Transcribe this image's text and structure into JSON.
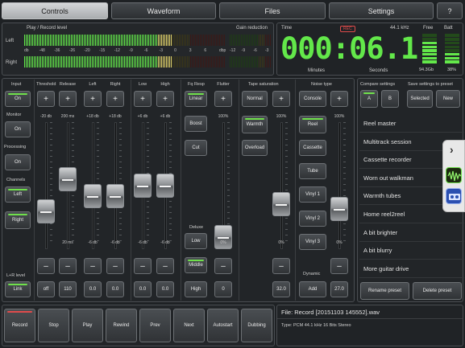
{
  "tabs": [
    {
      "label": "Controls",
      "active": true
    },
    {
      "label": "Waveform",
      "active": false
    },
    {
      "label": "Files",
      "active": false
    },
    {
      "label": "Settings",
      "active": false
    },
    {
      "label": "?",
      "active": false
    }
  ],
  "meter": {
    "title": "Play / Record level",
    "gain_title": "Gain reduction",
    "left": "Left",
    "right": "Right",
    "scale": [
      "db",
      "-48",
      "-36",
      "-26",
      "-20",
      "-15",
      "-12",
      "-9",
      "-6",
      "-3",
      "0",
      "3",
      "6",
      "dbp"
    ],
    "gain_scale": [
      "-12",
      "-9",
      "-6",
      "-3"
    ]
  },
  "clock": {
    "time_label": "Time",
    "rec_badge": "REC",
    "rate": "44.1 kHz",
    "free_label": "Free",
    "batt_label": "Batt",
    "digits": "000:06.1",
    "minutes_label": "Minutes",
    "seconds_label": "Seconds",
    "free_value": "94.3Gb",
    "batt_value": "38%",
    "free_level": 0.7,
    "batt_level": 0.38
  },
  "channels": [
    {
      "key": "threshold",
      "header": "Threshold",
      "top": "-20 db",
      "bottom": "",
      "value": "off",
      "level": 0.25
    },
    {
      "key": "release",
      "header": "Release",
      "top": "200 ms",
      "bottom": "20 ms",
      "value": "110",
      "level": 0.56
    },
    {
      "key": "left",
      "header": "Left",
      "top": "+18 db",
      "bottom": "-6 db",
      "value": "0.0",
      "level": 0.4
    },
    {
      "key": "right",
      "header": "Right",
      "top": "+18 db",
      "bottom": "-6 db",
      "value": "0.0",
      "level": 0.4
    },
    {
      "key": "low",
      "header": "Low",
      "top": "+6 db",
      "bottom": "-6 db",
      "value": "0.0",
      "level": 0.5
    },
    {
      "key": "high",
      "header": "High",
      "top": "+6 db",
      "bottom": "-6 db",
      "value": "0.0",
      "level": 0.5
    },
    {
      "key": "flutter",
      "header": "Flutter",
      "top": "100%",
      "bottom": "0%",
      "value": "0",
      "level": 0.0
    },
    {
      "key": "saturation",
      "header": "",
      "top": "100%",
      "bottom": "0%",
      "value": "32.0",
      "level": 0.32
    },
    {
      "key": "noise",
      "header": "",
      "top": "100%",
      "bottom": "0%",
      "value": "27.0",
      "level": 0.27
    }
  ],
  "input_col": {
    "header": "Input",
    "on_label": "On",
    "monitor": "Monitor",
    "monitor_on": "On",
    "processing": "Processing",
    "processing_on": "On",
    "channels": "Channels",
    "left_btn": "Left",
    "right_btn": "Right",
    "lr_level": "L+R level",
    "link": "Link"
  },
  "freq": {
    "header": "Fq Resp",
    "linear": "Linear",
    "boost": "Boost",
    "cut": "Cut",
    "deluxe": "Deluxe",
    "low": "Low",
    "middle": "Middle",
    "high": "High"
  },
  "saturation": {
    "header": "Tape saturation",
    "normal": "Normal",
    "warmth": "Warmth",
    "overload": "Overload"
  },
  "noise": {
    "header": "Noise type",
    "console": "Console",
    "reel": "Reel",
    "cassette": "Cassette",
    "tube": "Tube",
    "vinyl1": "Vinyl 1",
    "vinyl2": "Vinyl 2",
    "vinyl3": "Vinyl 3",
    "dynamic": "Dynamic",
    "add": "Add"
  },
  "presets": {
    "compare_label": "Compare settings",
    "save_label": "Save settings to preset",
    "a": "A",
    "b": "B",
    "selected": "Selected",
    "new": "New",
    "items": [
      "Reel master",
      "Multitrack session",
      "Cassette recorder",
      "Worn out walkman",
      "Warmth tubes",
      "Home reel2reel",
      "A bit brighter",
      "A bit blurry",
      "More guitar drive"
    ],
    "rename": "Rename preset",
    "delete": "Delete preset"
  },
  "transport": [
    "Record",
    "Stop",
    "Play",
    "Rewind",
    "Prev",
    "Next",
    "Autostart",
    "Dubbing"
  ],
  "file": {
    "name": "File: Record [20151103 145552].wav",
    "type": "Type: PCM 44.1 kHz 16 Bits Stereo"
  },
  "colors": {
    "led_green": "#63e84a",
    "record_red": "#e04b4b",
    "meter_yellow": "#e4d56a"
  }
}
